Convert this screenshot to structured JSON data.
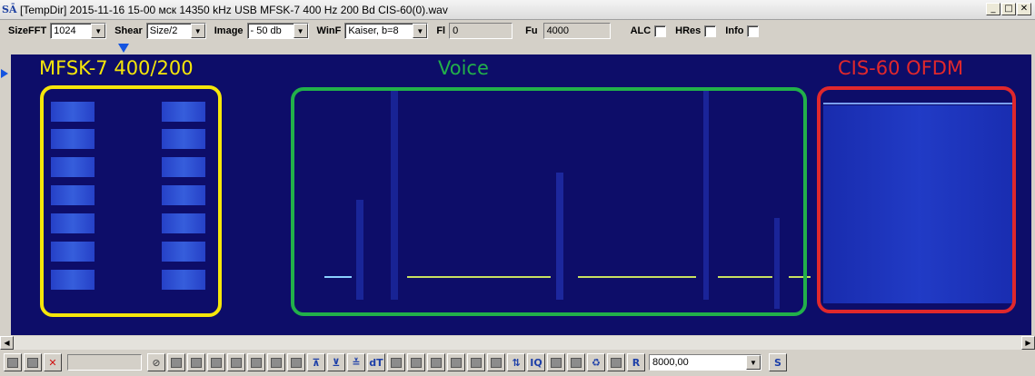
{
  "window": {
    "icon_text": "SĀ",
    "title": "[TempDir] 2015-11-16 15-00 мск 14350 kHz USB MFSK-7 400 Hz 200 Bd CIS-60(0).wav",
    "minimize": "_",
    "maximize": "□",
    "close": "✕"
  },
  "toolbar": {
    "sizefft_label": "SizeFFT",
    "sizefft_value": "1024",
    "shear_label": "Shear",
    "shear_value": "Size/2",
    "image_label": "Image",
    "image_value": "- 50 db",
    "winf_label": "WinF",
    "winf_value": "Kaiser, b=8",
    "fl_label": "Fl",
    "fl_value": "0",
    "fu_label": "Fu",
    "fu_value": "4000",
    "alc_label": "ALC",
    "hres_label": "HRes",
    "info_label": "Info",
    "dropdown_arrow": "▼"
  },
  "annotations": [
    {
      "label": "MFSK-7 400/200",
      "color": "#f5e60a"
    },
    {
      "label": "Voice",
      "color": "#22b04a"
    },
    {
      "label": "CIS-60 OFDM",
      "color": "#e0282c"
    }
  ],
  "bottombar": {
    "frequency_value": "8000,00",
    "s_button": "S",
    "r_button": "R",
    "dt_button": "dT",
    "iq_button": "IQ"
  },
  "scrollbar": {
    "left_arrow": "◀",
    "right_arrow": "▶"
  },
  "colors": {
    "spectrogram_bg": "#0a0a5a",
    "marker": "#1454e0"
  }
}
